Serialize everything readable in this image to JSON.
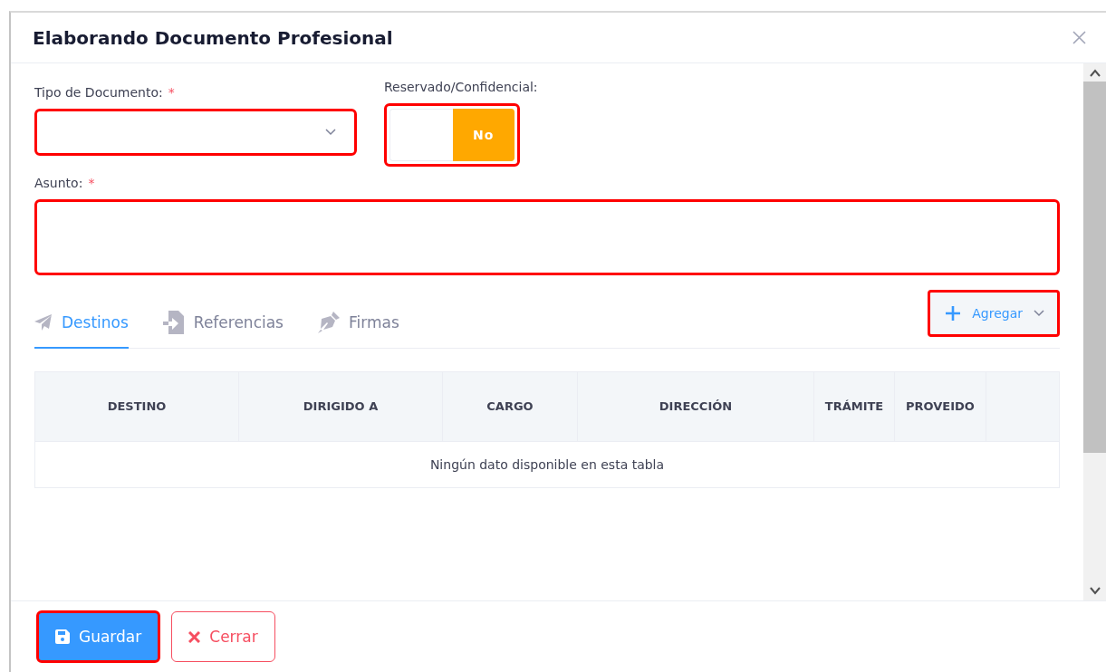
{
  "dialog": {
    "title": "Elaborando Documento Profesional"
  },
  "fields": [
    {
      "kind": "select",
      "label": "Tipo de Documento:",
      "required_mark": "*",
      "highlighted": true
    },
    {
      "kind": "toggle",
      "label": "Reservado/Confidencial:",
      "value": "No",
      "on": false,
      "highlighted": true
    },
    {
      "kind": "textarea",
      "label": "Asunto:",
      "required_mark": "*",
      "highlighted": true
    }
  ],
  "tabs": [
    {
      "label": "Destinos",
      "selected": true
    },
    {
      "label": "Referencias",
      "selected": false
    },
    {
      "label": "Firmas",
      "selected": false
    }
  ],
  "add_button": {
    "label": "Agregar",
    "highlighted": true
  },
  "table": {
    "columns": [
      "DESTINO",
      "DIRIGIDO A",
      "CARGO",
      "DIRECCIÓN",
      "TRÁMITE",
      "PROVEIDO"
    ],
    "empty_message": "Ningún dato disponible en esta tabla"
  },
  "buttons": [
    {
      "kind": "primary",
      "label": "Guardar",
      "highlighted": true
    },
    {
      "kind": "danger",
      "label": "Cerrar",
      "highlighted": false
    }
  ]
}
